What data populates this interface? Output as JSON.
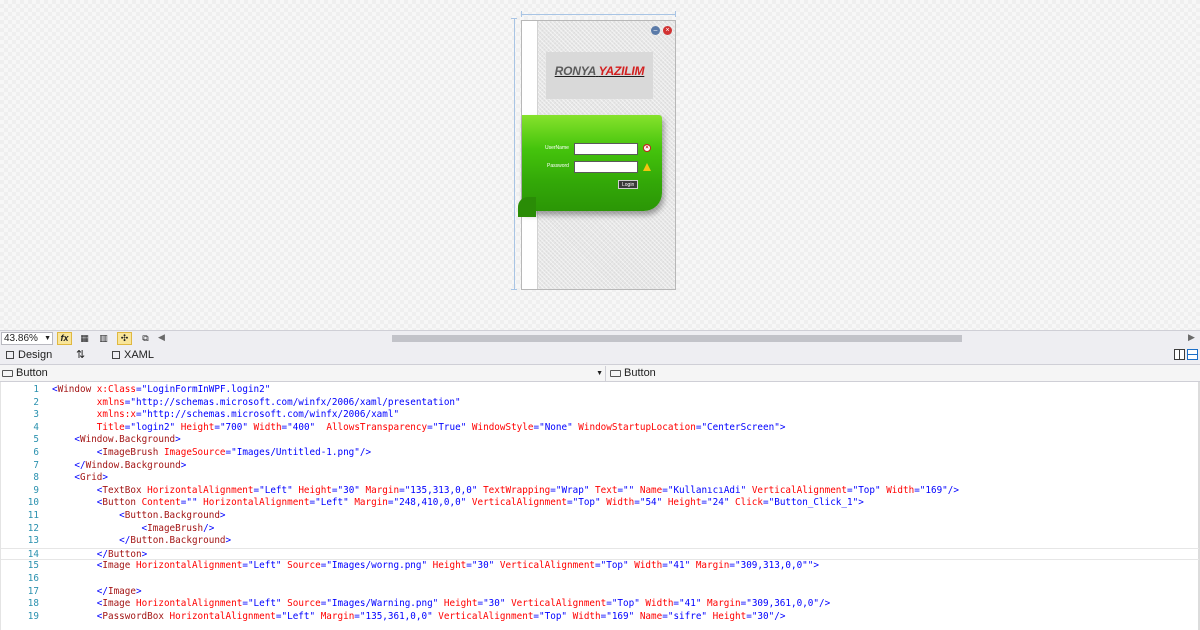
{
  "designer": {
    "login_window": {
      "logo_part1": "RONYA",
      "logo_part2": "YAZILIM",
      "username_label": "UserName",
      "password_label": "Password",
      "username_value": "",
      "password_value": "",
      "login_button": "Login"
    }
  },
  "zoom_toolbar": {
    "zoom_level": "43.86%",
    "fx_label": "fx"
  },
  "tabs": {
    "design": "Design",
    "swap": "⇅",
    "xaml": "XAML"
  },
  "selectors": {
    "left": "Button",
    "right": "Button"
  },
  "editor": {
    "lines": [
      {
        "n": "1",
        "parts": [
          [
            "p",
            "<"
          ],
          [
            "t",
            "Window"
          ],
          [
            "a",
            " x:Class"
          ],
          [
            "p",
            "="
          ],
          [
            "v",
            "\"LoginFormInWPF.login2\""
          ]
        ]
      },
      {
        "n": "2",
        "parts": [
          [
            "a",
            "        xmlns"
          ],
          [
            "p",
            "="
          ],
          [
            "v",
            "\"http://schemas.microsoft.com/winfx/2006/xaml/presentation\""
          ]
        ]
      },
      {
        "n": "3",
        "parts": [
          [
            "a",
            "        xmlns:x"
          ],
          [
            "p",
            "="
          ],
          [
            "v",
            "\"http://schemas.microsoft.com/winfx/2006/xaml\""
          ]
        ]
      },
      {
        "n": "4",
        "parts": [
          [
            "a",
            "        Title"
          ],
          [
            "p",
            "="
          ],
          [
            "v",
            "\"login2\""
          ],
          [
            "a",
            " Height"
          ],
          [
            "p",
            "="
          ],
          [
            "v",
            "\"700\""
          ],
          [
            "a",
            " Width"
          ],
          [
            "p",
            "="
          ],
          [
            "v",
            "\"400\""
          ],
          [
            "a",
            "  AllowsTransparency"
          ],
          [
            "p",
            "="
          ],
          [
            "v",
            "\"True\""
          ],
          [
            "a",
            " WindowStyle"
          ],
          [
            "p",
            "="
          ],
          [
            "v",
            "\"None\""
          ],
          [
            "a",
            " WindowStartupLocation"
          ],
          [
            "p",
            "="
          ],
          [
            "v",
            "\"CenterScreen\""
          ],
          [
            "p",
            ">"
          ]
        ]
      },
      {
        "n": "5",
        "parts": [
          [
            "p",
            "    <"
          ],
          [
            "t",
            "Window.Background"
          ],
          [
            "p",
            ">"
          ]
        ]
      },
      {
        "n": "6",
        "parts": [
          [
            "p",
            "        <"
          ],
          [
            "t",
            "ImageBrush"
          ],
          [
            "a",
            " ImageSource"
          ],
          [
            "p",
            "="
          ],
          [
            "v",
            "\"Images/Untitled-1.png\""
          ],
          [
            "p",
            "/>"
          ]
        ]
      },
      {
        "n": "7",
        "parts": [
          [
            "p",
            "    </"
          ],
          [
            "t",
            "Window.Background"
          ],
          [
            "p",
            ">"
          ]
        ]
      },
      {
        "n": "8",
        "parts": [
          [
            "p",
            "    <"
          ],
          [
            "t",
            "Grid"
          ],
          [
            "p",
            ">"
          ]
        ]
      },
      {
        "n": "9",
        "parts": [
          [
            "p",
            "        <"
          ],
          [
            "t",
            "TextBox"
          ],
          [
            "a",
            " HorizontalAlignment"
          ],
          [
            "p",
            "="
          ],
          [
            "v",
            "\"Left\""
          ],
          [
            "a",
            " Height"
          ],
          [
            "p",
            "="
          ],
          [
            "v",
            "\"30\""
          ],
          [
            "a",
            " Margin"
          ],
          [
            "p",
            "="
          ],
          [
            "v",
            "\"135,313,0,0\""
          ],
          [
            "a",
            " TextWrapping"
          ],
          [
            "p",
            "="
          ],
          [
            "v",
            "\"Wrap\""
          ],
          [
            "a",
            " Text"
          ],
          [
            "p",
            "="
          ],
          [
            "v",
            "\"\""
          ],
          [
            "a",
            " Name"
          ],
          [
            "p",
            "="
          ],
          [
            "v",
            "\"KullanıcıAdi\""
          ],
          [
            "a",
            " VerticalAlignment"
          ],
          [
            "p",
            "="
          ],
          [
            "v",
            "\"Top\""
          ],
          [
            "a",
            " Width"
          ],
          [
            "p",
            "="
          ],
          [
            "v",
            "\"169\""
          ],
          [
            "p",
            "/>"
          ]
        ]
      },
      {
        "n": "10",
        "parts": [
          [
            "p",
            "        <"
          ],
          [
            "t",
            "Button"
          ],
          [
            "a",
            " Content"
          ],
          [
            "p",
            "="
          ],
          [
            "v",
            "\"\""
          ],
          [
            "a",
            " HorizontalAlignment"
          ],
          [
            "p",
            "="
          ],
          [
            "v",
            "\"Left\""
          ],
          [
            "a",
            " Margin"
          ],
          [
            "p",
            "="
          ],
          [
            "v",
            "\"248,410,0,0\""
          ],
          [
            "a",
            " VerticalAlignment"
          ],
          [
            "p",
            "="
          ],
          [
            "v",
            "\"Top\""
          ],
          [
            "a",
            " Width"
          ],
          [
            "p",
            "="
          ],
          [
            "v",
            "\"54\""
          ],
          [
            "a",
            " Height"
          ],
          [
            "p",
            "="
          ],
          [
            "v",
            "\"24\""
          ],
          [
            "a",
            " Click"
          ],
          [
            "p",
            "="
          ],
          [
            "v",
            "\"Button_Click_1\""
          ],
          [
            "p",
            ">"
          ]
        ]
      },
      {
        "n": "11",
        "parts": [
          [
            "p",
            "            <"
          ],
          [
            "t",
            "Button.Background"
          ],
          [
            "p",
            ">"
          ]
        ]
      },
      {
        "n": "12",
        "parts": [
          [
            "p",
            "                <"
          ],
          [
            "t",
            "ImageBrush"
          ],
          [
            "p",
            "/>"
          ]
        ]
      },
      {
        "n": "13",
        "parts": [
          [
            "p",
            "            </"
          ],
          [
            "t",
            "Button.Background"
          ],
          [
            "p",
            ">"
          ]
        ]
      },
      {
        "n": "14",
        "parts": [
          [
            "p",
            "        </"
          ],
          [
            "t",
            "Button"
          ],
          [
            "p",
            ">"
          ]
        ],
        "current": true
      },
      {
        "n": "15",
        "parts": [
          [
            "p",
            "        <"
          ],
          [
            "t",
            "Image"
          ],
          [
            "a",
            " HorizontalAlignment"
          ],
          [
            "p",
            "="
          ],
          [
            "v",
            "\"Left\""
          ],
          [
            "a",
            " Source"
          ],
          [
            "p",
            "="
          ],
          [
            "v",
            "\"Images/worng.png\""
          ],
          [
            "a",
            " Height"
          ],
          [
            "p",
            "="
          ],
          [
            "v",
            "\"30\""
          ],
          [
            "a",
            " VerticalAlignment"
          ],
          [
            "p",
            "="
          ],
          [
            "v",
            "\"Top\""
          ],
          [
            "a",
            " Width"
          ],
          [
            "p",
            "="
          ],
          [
            "v",
            "\"41\""
          ],
          [
            "a",
            " Margin"
          ],
          [
            "p",
            "="
          ],
          [
            "v",
            "\"309,313,0,0\""
          ],
          [
            "p",
            "\">"
          ]
        ]
      },
      {
        "n": "16",
        "parts": []
      },
      {
        "n": "17",
        "parts": [
          [
            "p",
            "        </"
          ],
          [
            "t",
            "Image"
          ],
          [
            "p",
            ">"
          ]
        ]
      },
      {
        "n": "18",
        "parts": [
          [
            "p",
            "        <"
          ],
          [
            "t",
            "Image"
          ],
          [
            "a",
            " HorizontalAlignment"
          ],
          [
            "p",
            "="
          ],
          [
            "v",
            "\"Left\""
          ],
          [
            "a",
            " Source"
          ],
          [
            "p",
            "="
          ],
          [
            "v",
            "\"Images/Warning.png\""
          ],
          [
            "a",
            " Height"
          ],
          [
            "p",
            "="
          ],
          [
            "v",
            "\"30\""
          ],
          [
            "a",
            " VerticalAlignment"
          ],
          [
            "p",
            "="
          ],
          [
            "v",
            "\"Top\""
          ],
          [
            "a",
            " Width"
          ],
          [
            "p",
            "="
          ],
          [
            "v",
            "\"41\""
          ],
          [
            "a",
            " Margin"
          ],
          [
            "p",
            "="
          ],
          [
            "v",
            "\"309,361,0,0\""
          ],
          [
            "p",
            "/>"
          ]
        ]
      },
      {
        "n": "19",
        "parts": [
          [
            "p",
            "        <"
          ],
          [
            "t",
            "PasswordBox"
          ],
          [
            "a",
            " HorizontalAlignment"
          ],
          [
            "p",
            "="
          ],
          [
            "v",
            "\"Left\""
          ],
          [
            "a",
            " Margin"
          ],
          [
            "p",
            "="
          ],
          [
            "v",
            "\"135,361,0,0\""
          ],
          [
            "a",
            " VerticalAlignment"
          ],
          [
            "p",
            "="
          ],
          [
            "v",
            "\"Top\""
          ],
          [
            "a",
            " Width"
          ],
          [
            "p",
            "="
          ],
          [
            "v",
            "\"169\""
          ],
          [
            "a",
            " Name"
          ],
          [
            "p",
            "="
          ],
          [
            "v",
            "\"sifre\""
          ],
          [
            "a",
            " Height"
          ],
          [
            "p",
            "="
          ],
          [
            "v",
            "\"30\""
          ],
          [
            "p",
            "/>"
          ]
        ]
      }
    ]
  },
  "colors": {
    "xml_tag": "#a31515",
    "xml_attribute": "#ff0000",
    "xml_value": "#0000ff",
    "line_number": "#2b91af",
    "login_panel_green": "#45c40c",
    "logo_accent": "#d32020"
  },
  "icons": {
    "minimize": "minimize-icon",
    "close": "close-icon",
    "error": "error-x-icon",
    "warning": "warning-icon",
    "grid": "grid-icon",
    "snap_gridlines": "snap-gridlines-icon",
    "snap_lines": "snap-lines-icon",
    "effects": "effects-icon",
    "design_tab": "design-view-icon",
    "xaml_tab": "xaml-view-icon",
    "element": "element-icon",
    "split": "split-view-icon"
  }
}
